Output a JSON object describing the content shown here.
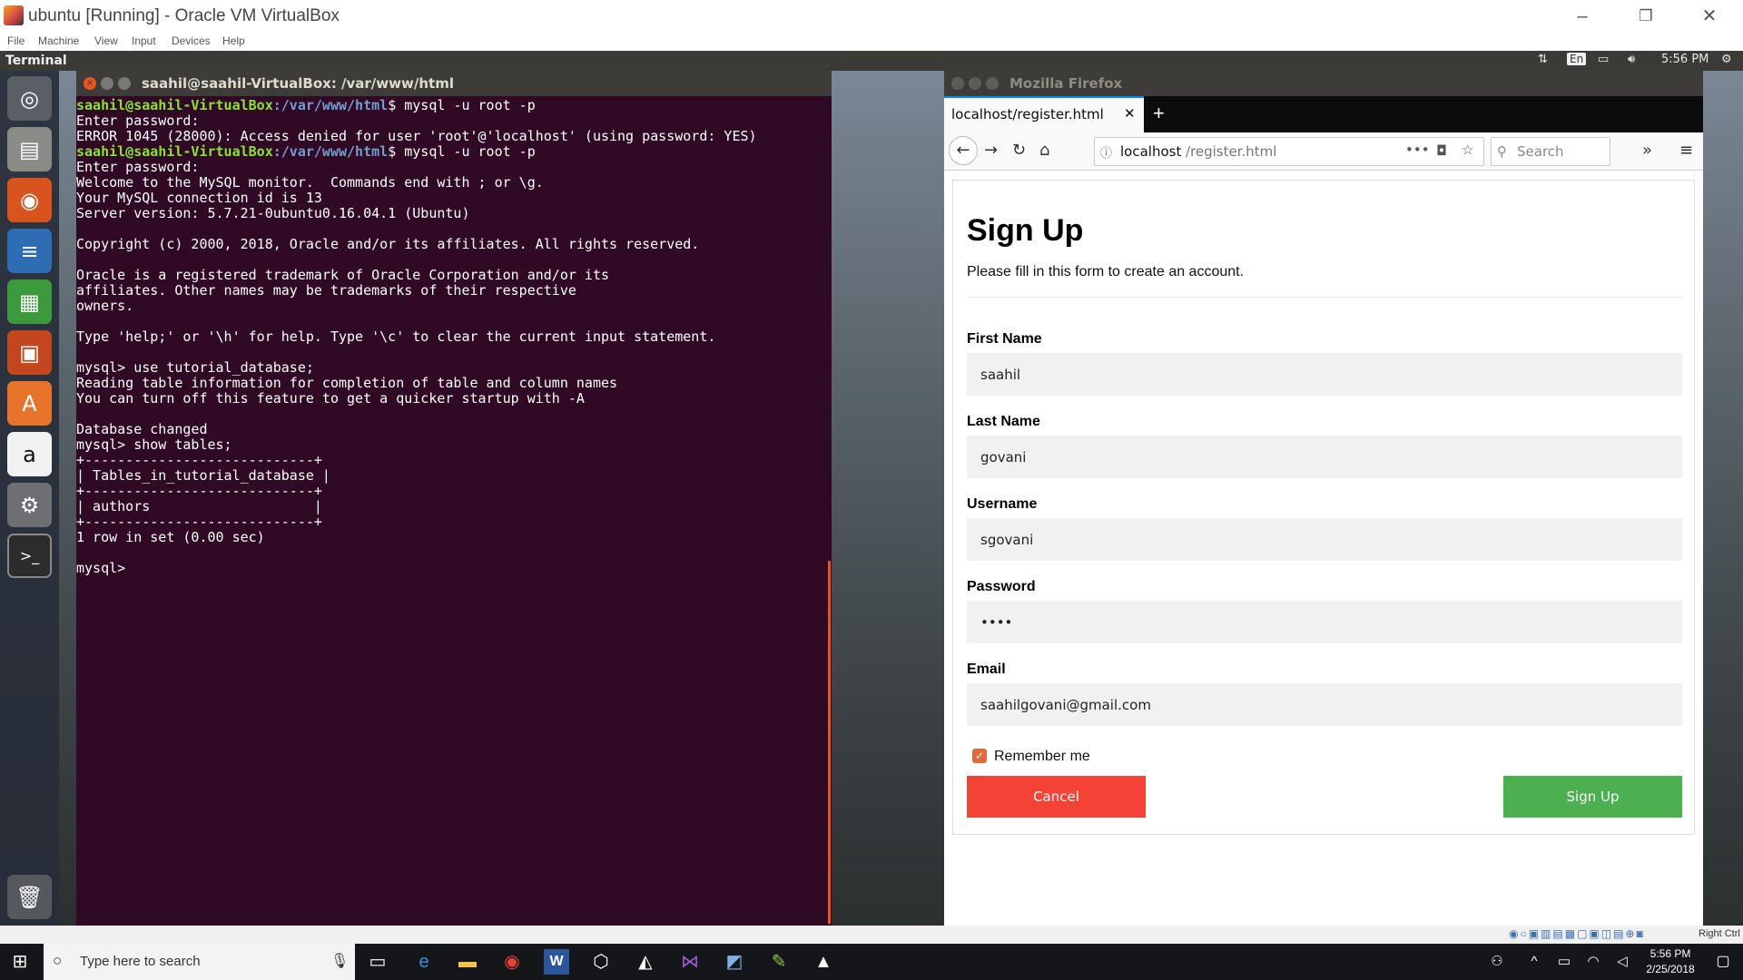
{
  "host": {
    "title": "ubuntu [Running] - Oracle VM VirtualBox",
    "menu": [
      "File",
      "Machine",
      "View",
      "Input",
      "Devices",
      "Help"
    ],
    "status_right": "Right Ctrl"
  },
  "ubuntu_panel": {
    "app_name": "Terminal",
    "lang": "En",
    "time": "5:56 PM"
  },
  "launcher": [
    {
      "icon": "ubuntu-dash-icon"
    },
    {
      "icon": "files-icon"
    },
    {
      "icon": "firefox-icon"
    },
    {
      "icon": "libreoffice-writer-icon"
    },
    {
      "icon": "libreoffice-calc-icon"
    },
    {
      "icon": "libreoffice-impress-icon"
    },
    {
      "icon": "software-center-icon"
    },
    {
      "icon": "amazon-icon"
    },
    {
      "icon": "system-settings-icon"
    },
    {
      "icon": "terminal-icon"
    },
    {
      "icon": "trash-icon"
    }
  ],
  "terminal": {
    "title": "saahil@saahil-VirtualBox: /var/www/html",
    "prompt_user": "saahil@saahil-VirtualBox",
    "prompt_path": ":/var/www/html",
    "lines": [
      {
        "type": "prompt",
        "cmd": "$ mysql -u root -p"
      },
      {
        "type": "out",
        "text": "Enter password:"
      },
      {
        "type": "out",
        "text": "ERROR 1045 (28000): Access denied for user 'root'@'localhost' (using password: YES)"
      },
      {
        "type": "prompt",
        "cmd": "$ mysql -u root -p"
      },
      {
        "type": "out",
        "text": "Enter password:"
      },
      {
        "type": "out",
        "text": "Welcome to the MySQL monitor.  Commands end with ; or \\g."
      },
      {
        "type": "out",
        "text": "Your MySQL connection id is 13"
      },
      {
        "type": "out",
        "text": "Server version: 5.7.21-0ubuntu0.16.04.1 (Ubuntu)"
      },
      {
        "type": "out",
        "text": ""
      },
      {
        "type": "out",
        "text": "Copyright (c) 2000, 2018, Oracle and/or its affiliates. All rights reserved."
      },
      {
        "type": "out",
        "text": ""
      },
      {
        "type": "out",
        "text": "Oracle is a registered trademark of Oracle Corporation and/or its"
      },
      {
        "type": "out",
        "text": "affiliates. Other names may be trademarks of their respective"
      },
      {
        "type": "out",
        "text": "owners."
      },
      {
        "type": "out",
        "text": ""
      },
      {
        "type": "out",
        "text": "Type 'help;' or '\\h' for help. Type '\\c' to clear the current input statement."
      },
      {
        "type": "out",
        "text": ""
      },
      {
        "type": "out",
        "text": "mysql> use tutorial_database;"
      },
      {
        "type": "out",
        "text": "Reading table information for completion of table and column names"
      },
      {
        "type": "out",
        "text": "You can turn off this feature to get a quicker startup with -A"
      },
      {
        "type": "out",
        "text": ""
      },
      {
        "type": "out",
        "text": "Database changed"
      },
      {
        "type": "out",
        "text": "mysql> show tables;"
      },
      {
        "type": "out",
        "text": "+----------------------------+"
      },
      {
        "type": "out",
        "text": "| Tables_in_tutorial_database |"
      },
      {
        "type": "out",
        "text": "+----------------------------+"
      },
      {
        "type": "out",
        "text": "| authors                    |"
      },
      {
        "type": "out",
        "text": "+----------------------------+"
      },
      {
        "type": "out",
        "text": "1 row in set (0.00 sec)"
      },
      {
        "type": "out",
        "text": ""
      },
      {
        "type": "out",
        "text": "mysql> "
      }
    ]
  },
  "firefox": {
    "window_title": "Mozilla Firefox",
    "tab_title": "localhost/register.html",
    "url_host": "localhost",
    "url_path": "/register.html",
    "search_placeholder": "Search",
    "page": {
      "heading": "Sign Up",
      "subtitle": "Please fill in this form to create an account.",
      "fields": [
        {
          "label": "First Name",
          "value": "saahil"
        },
        {
          "label": "Last Name",
          "value": "govani"
        },
        {
          "label": "Username",
          "value": "sgovani"
        },
        {
          "label": "Password",
          "value": "••••"
        },
        {
          "label": "Email",
          "value": "saahilgovani@gmail.com"
        }
      ],
      "remember_label": "Remember me",
      "remember_checked": true,
      "cancel_label": "Cancel",
      "signup_label": "Sign Up",
      "colors": {
        "cancel": "#f44336",
        "signup": "#4caf50",
        "checkbox": "#e2693b"
      }
    }
  },
  "taskbar": {
    "search_placeholder": "Type here to search",
    "time": "5:56 PM",
    "date": "2/25/2018"
  }
}
